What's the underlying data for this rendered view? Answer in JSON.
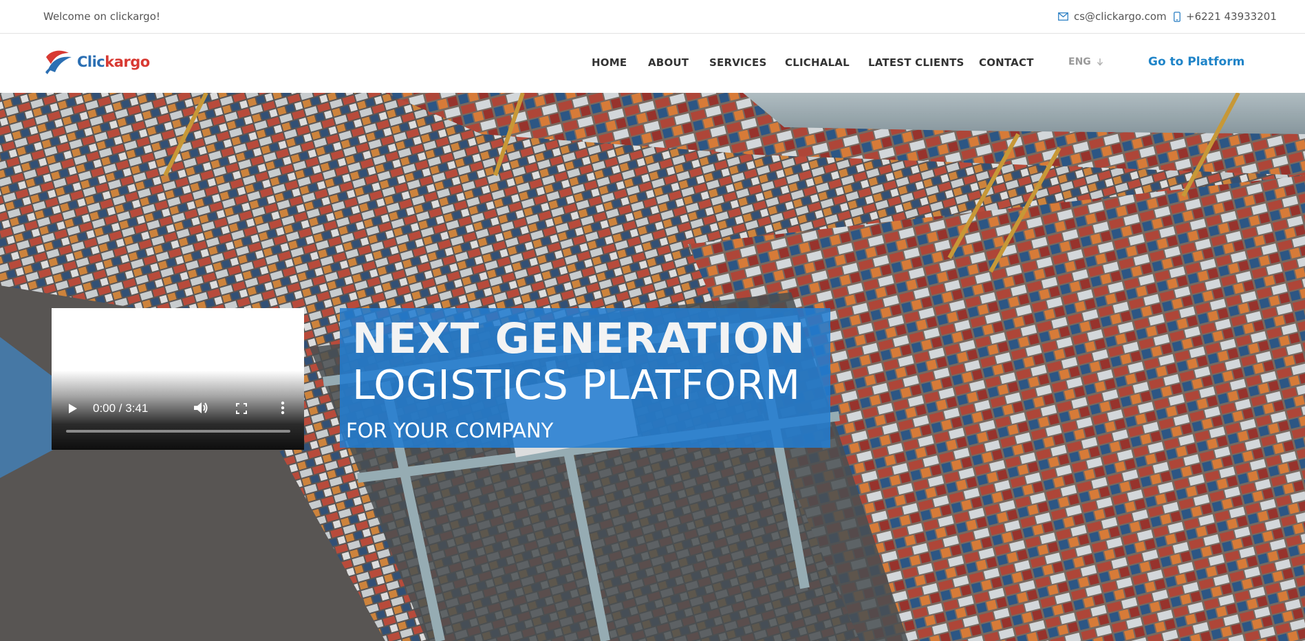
{
  "topbar": {
    "welcome": "Welcome on clickargo!",
    "email": "cs@clickargo.com",
    "email_icon": "envelope-icon",
    "phone": "+6221 43933201",
    "phone_icon": "mobile-phone-icon"
  },
  "brand": {
    "name_part1": "Clic",
    "name_part2": "kargo",
    "logo_icon": "clickargo-logo-icon",
    "colors": {
      "blue": "#2b6fb3",
      "red": "#d83a33",
      "accent": "#1f84c8"
    }
  },
  "nav": {
    "items": [
      {
        "label": "HOME"
      },
      {
        "label": "ABOUT"
      },
      {
        "label": "SERVICES"
      },
      {
        "label": "CLICHALAL"
      },
      {
        "label": "LATEST CLIENTS"
      },
      {
        "label": "CONTACT"
      }
    ],
    "language": "ENG",
    "language_icon": "arrow-down-icon",
    "platform_link": "Go to Platform"
  },
  "hero": {
    "background": "container-port-aerial-photo",
    "line1": "NEXT GENERATION",
    "line2": "LOGISTICS PLATFORM",
    "line3": "FOR YOUR COMPANY",
    "box_color": "#227dd2"
  },
  "video": {
    "time": "0:00 / 3:41",
    "progress": 0,
    "controls": [
      "play-icon",
      "volume-icon",
      "fullscreen-icon",
      "more-options-icon"
    ]
  }
}
